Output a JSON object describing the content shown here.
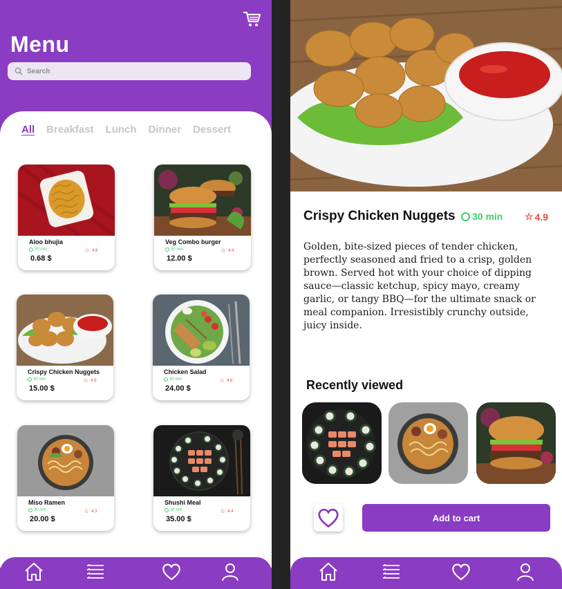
{
  "colors": {
    "brand": "#8a3cc2",
    "time_green": "#3fd26a",
    "rating_red": "#e24a3b"
  },
  "menu_screen": {
    "title": "Menu",
    "cart_icon": "shopping-cart-icon",
    "search": {
      "placeholder": "Search",
      "icon": "search-icon"
    },
    "tabs": [
      {
        "label": "All",
        "active": true
      },
      {
        "label": "Breakfast",
        "active": false
      },
      {
        "label": "Lunch",
        "active": false
      },
      {
        "label": "Dinner",
        "active": false
      },
      {
        "label": "Dessert",
        "active": false
      }
    ],
    "items": [
      {
        "name": "Aloo bhujia",
        "time": "30 min",
        "rating": "4.8",
        "price": "0.68 $"
      },
      {
        "name": "Veg Combo burger",
        "time": "30 min",
        "rating": "4.4",
        "price": "12.00 $"
      },
      {
        "name": "Crispy Chicken Nuggets",
        "time": "30 min",
        "rating": "4.9",
        "price": "15.00 $"
      },
      {
        "name": "Chicken Salad",
        "time": "30 min",
        "rating": "4.8",
        "price": "24.00 $"
      },
      {
        "name": "Miso Ramen",
        "time": "30 min",
        "rating": "4.3",
        "price": "20.00 $"
      },
      {
        "name": "Shushi  Meal",
        "time": "30 min",
        "rating": "4.4",
        "price": "35.00 $"
      }
    ],
    "nav": [
      "home-icon",
      "list-icon",
      "heart-icon",
      "user-icon"
    ]
  },
  "detail_screen": {
    "title": "Crispy Chicken Nuggets",
    "time": "30 min",
    "rating": "4.9",
    "description": "Golden, bite-sized pieces of tender chicken, perfectly seasoned and fried to a crisp, golden brown. Served hot with your choice of dipping sauce—classic ketchup, spicy mayo, creamy garlic, or tangy BBQ—for the ultimate snack or meal companion. Irresistibly crunchy outside, juicy inside.",
    "recently_viewed_title": "Recently viewed",
    "recently_viewed": [
      "sushi",
      "ramen",
      "burger"
    ],
    "add_to_cart": "Add to cart",
    "nav": [
      "home-icon",
      "list-icon",
      "heart-icon",
      "user-icon"
    ]
  }
}
